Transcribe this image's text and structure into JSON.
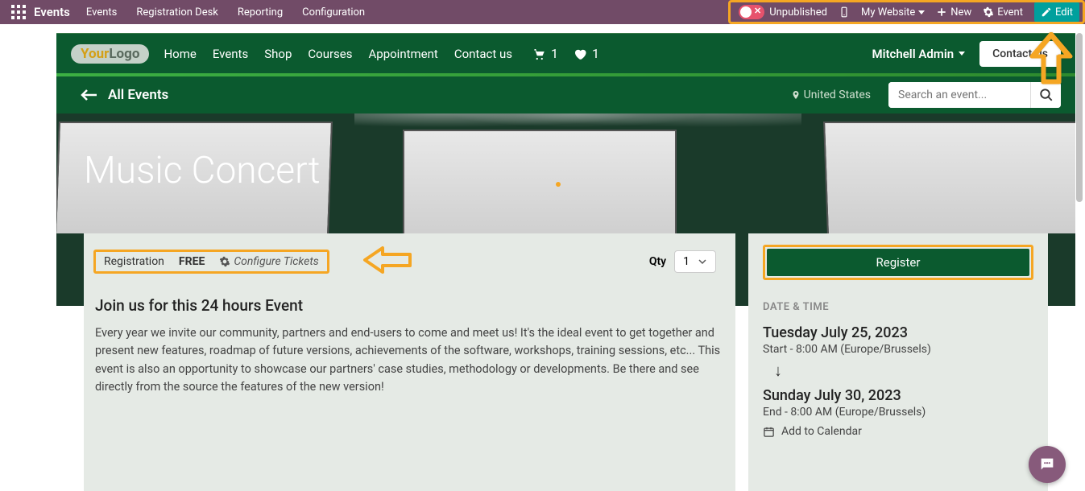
{
  "topbar": {
    "app_title": "Events",
    "menu": [
      "Events",
      "Registration Desk",
      "Reporting",
      "Configuration"
    ],
    "publish_label": "Unpublished",
    "website_label": "My Website",
    "new_label": "New",
    "event_label": "Event",
    "edit_label": "Edit"
  },
  "site_nav": {
    "items": [
      "Home",
      "Events",
      "Shop",
      "Courses",
      "Appointment",
      "Contact us"
    ],
    "cart_count": "1",
    "wishlist_count": "1",
    "user_name": "Mitchell Admin",
    "contact_btn": "Contact Us"
  },
  "breadcrumb": {
    "back_label": "All Events",
    "location": "United States",
    "search_placeholder": "Search an event..."
  },
  "hero": {
    "title": "Music Concert"
  },
  "registration": {
    "label": "Registration",
    "price": "FREE",
    "configure": "Configure Tickets",
    "qty_label": "Qty",
    "qty_value": "1",
    "register_btn": "Register"
  },
  "event_body": {
    "subtitle": "Join us for this 24 hours Event",
    "description": "Every year we invite our community, partners and end-users to come and meet us! It's the ideal event to get together and present new features, roadmap of future versions, achievements of the software, workshops, training sessions, etc... This event is also an opportunity to showcase our partners' case studies, methodology or developments. Be there and see directly from the source the features of the new version!"
  },
  "datetime": {
    "header": "DATE & TIME",
    "start_date": "Tuesday July 25, 2023",
    "start_time": "Start - 8:00 AM (Europe/Brussels)",
    "end_date": "Sunday July 30, 2023",
    "end_time": "End - 8:00 AM (Europe/Brussels)",
    "add_calendar": "Add to Calendar"
  }
}
